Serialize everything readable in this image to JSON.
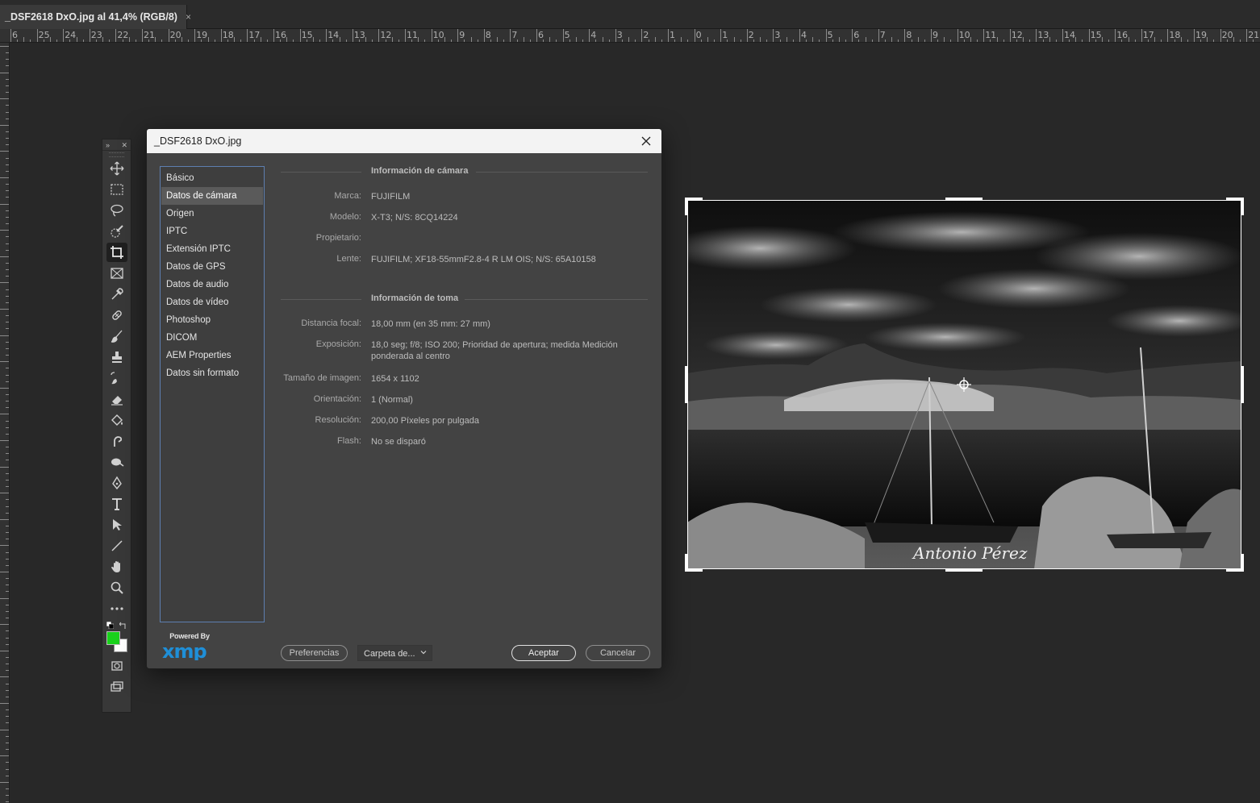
{
  "tab": {
    "title": "_DSF2618 DxO.jpg al 41,4% (RGB/8)",
    "close": "×"
  },
  "ruler": {
    "labels": [
      "6",
      "25",
      "24",
      "23",
      "22",
      "21",
      "20",
      "19",
      "18",
      "17",
      "16",
      "15",
      "14",
      "13",
      "12",
      "11",
      "10",
      "9",
      "8",
      "7",
      "6",
      "5",
      "4",
      "3",
      "2",
      "1",
      "0",
      "1",
      "2",
      "3",
      "4",
      "5",
      "6",
      "7",
      "8",
      "9",
      "10",
      "11",
      "12",
      "13",
      "14",
      "15",
      "16",
      "17",
      "18",
      "19",
      "20",
      "21"
    ]
  },
  "toolbar": {
    "tools": [
      "move-icon",
      "marquee-icon",
      "lasso-icon",
      "quick-select-icon",
      "crop-icon",
      "frame-icon",
      "eyedropper-icon",
      "healing-icon",
      "brush-icon",
      "stamp-icon",
      "history-brush-icon",
      "eraser-icon",
      "paint-bucket-icon",
      "smudge-icon",
      "dodge-icon",
      "pen-icon",
      "type-icon",
      "path-select-icon",
      "line-icon",
      "hand-icon",
      "zoom-icon",
      "more-icon"
    ],
    "foreground": "#19d11b",
    "background": "#ffffff"
  },
  "dialog": {
    "title": "_DSF2618 DxO.jpg",
    "categories": [
      "Básico",
      "Datos de cámara",
      "Origen",
      "IPTC",
      "Extensión IPTC",
      "Datos de GPS",
      "Datos de audio",
      "Datos de vídeo",
      "Photoshop",
      "DICOM",
      "AEM Properties",
      "Datos sin formato"
    ],
    "selected_index": 1,
    "camera_section": {
      "title": "Información de cámara",
      "rows": [
        {
          "label": "Marca:",
          "value": "FUJIFILM"
        },
        {
          "label": "Modelo:",
          "value": "X-T3;   N/S: 8CQ14224"
        },
        {
          "label": "Propietario:",
          "value": ""
        },
        {
          "label": "Lente:",
          "value": "FUJIFILM;   XF18-55mmF2.8-4 R LM OIS;   N/S: 65A10158"
        }
      ]
    },
    "shot_section": {
      "title": "Información de toma",
      "rows": [
        {
          "label": "Distancia focal:",
          "value": "18,00 mm    (en 35 mm: 27 mm)"
        },
        {
          "label": "Exposición:",
          "value": "18,0 seg;    f/8;    ISO 200;    Prioridad de apertura;    medida Medición ponderada al centro"
        },
        {
          "label": "Tamaño de imagen:",
          "value": "1654 x 1102"
        },
        {
          "label": "Orientación:",
          "value": "1 (Normal)"
        },
        {
          "label": "Resolución:",
          "value": "200,00 Píxeles por pulgada"
        },
        {
          "label": "Flash:",
          "value": "No se disparó"
        }
      ]
    },
    "powered_by": "Powered By",
    "xmp_logo": "xmp",
    "buttons": {
      "preferences": "Preferencias",
      "folder": "Carpeta de...",
      "accept": "Aceptar",
      "cancel": "Cancelar"
    },
    "xmp_color": "#1f8fd8"
  },
  "photo": {
    "watermark": "Antonio Pérez"
  }
}
